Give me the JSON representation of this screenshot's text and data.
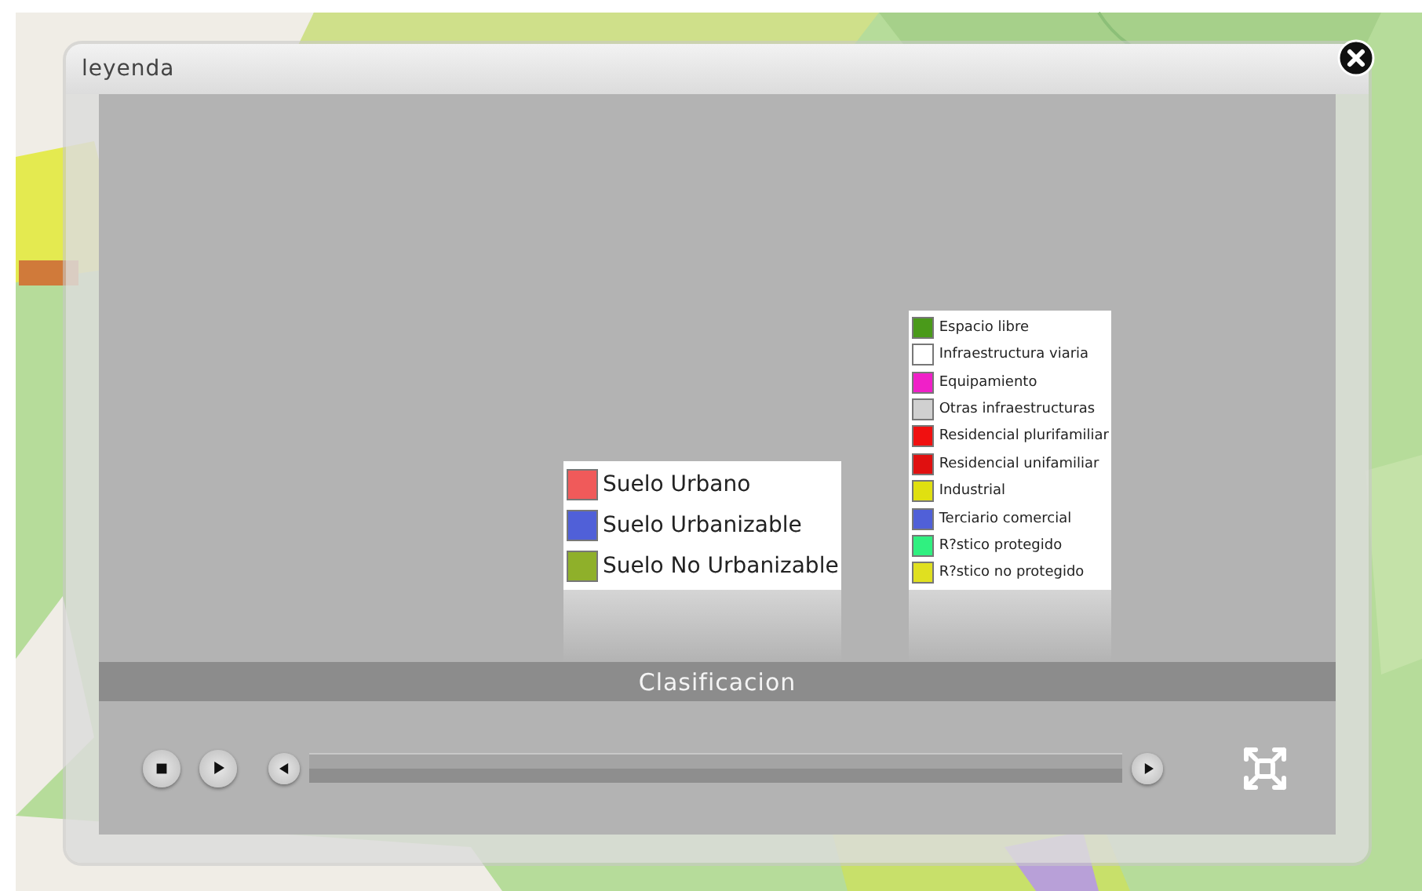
{
  "window": {
    "title": "leyenda"
  },
  "legends": [
    {
      "kind": "large",
      "items": [
        {
          "label": "Suelo Urbano",
          "color": "#f05a5a"
        },
        {
          "label": "Suelo Urbanizable",
          "color": "#5060d8"
        },
        {
          "label": "Suelo No Urbanizable",
          "color": "#8fb02a"
        }
      ]
    },
    {
      "kind": "small",
      "items": [
        {
          "label": "Espacio libre",
          "color": "#4a9a1a"
        },
        {
          "label": "Infraestructura viaria",
          "color": "#ffffff"
        },
        {
          "label": "Equipamiento",
          "color": "#f020c8"
        },
        {
          "label": "Otras infraestructuras",
          "color": "#d0d0d0"
        },
        {
          "label": "Residencial plurifamiliar",
          "color": "#f01010"
        },
        {
          "label": "Residencial unifamiliar",
          "color": "#e01010"
        },
        {
          "label": "Industrial",
          "color": "#e0e010"
        },
        {
          "label": "Terciario comercial",
          "color": "#5060d8"
        },
        {
          "label": "R?stico protegido",
          "color": "#30f080"
        },
        {
          "label": "R?stico no protegido",
          "color": "#e0e020"
        }
      ]
    }
  ],
  "caption": "Clasificacion"
}
